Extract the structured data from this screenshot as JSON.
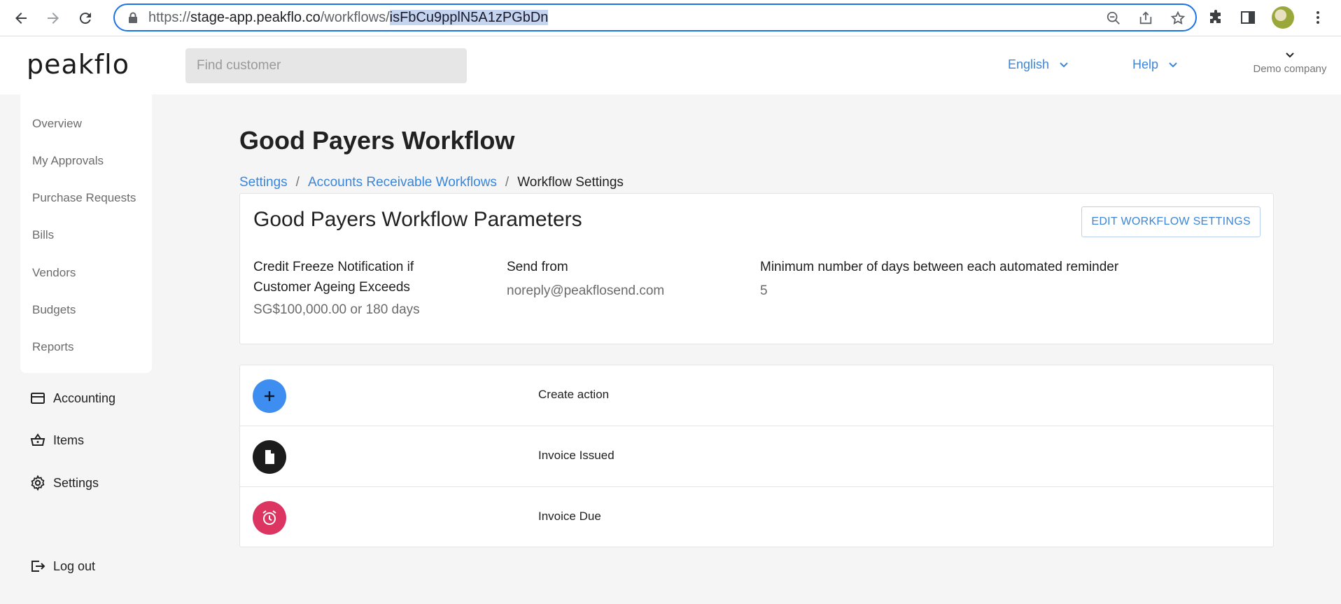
{
  "browser": {
    "url_prefix": "https://",
    "url_host": "stage-app.peakflo.co",
    "url_path": "/workflows/",
    "url_selected": "isFbCu9pplN5A1zPGbDn"
  },
  "header": {
    "logo": "peakflo",
    "search_placeholder": "Find customer",
    "language": "English",
    "help": "Help",
    "company": "Demo company"
  },
  "sidebar": {
    "items": [
      "Overview",
      "My Approvals",
      "Purchase Requests",
      "Bills",
      "Vendors",
      "Budgets",
      "Reports"
    ],
    "accounting": "Accounting",
    "items_link": "Items",
    "settings": "Settings",
    "logout": "Log out"
  },
  "page": {
    "title": "Good Payers Workflow",
    "breadcrumb": [
      "Settings",
      "Accounts Receivable Workflows",
      "Workflow Settings"
    ]
  },
  "params": {
    "title": "Good Payers Workflow Parameters",
    "edit_label": "EDIT WORKFLOW SETTINGS",
    "credit_label_1": "Credit Freeze Notification if",
    "credit_label_2": "Customer Ageing Exceeds",
    "credit_value": "SG$100,000.00 or 180 days",
    "send_label": "Send from",
    "send_value": "noreply@peakflosend.com",
    "days_label": "Minimum number of days between each automated reminder",
    "days_value": "5"
  },
  "actions": [
    {
      "label": "Create action",
      "icon": "plus-icon",
      "color": "#3d8ef0"
    },
    {
      "label": "Invoice Issued",
      "icon": "document-icon",
      "color": "#1c1c1c"
    },
    {
      "label": "Invoice Due",
      "icon": "alarm-clock-icon",
      "color": "#dd3562"
    }
  ]
}
